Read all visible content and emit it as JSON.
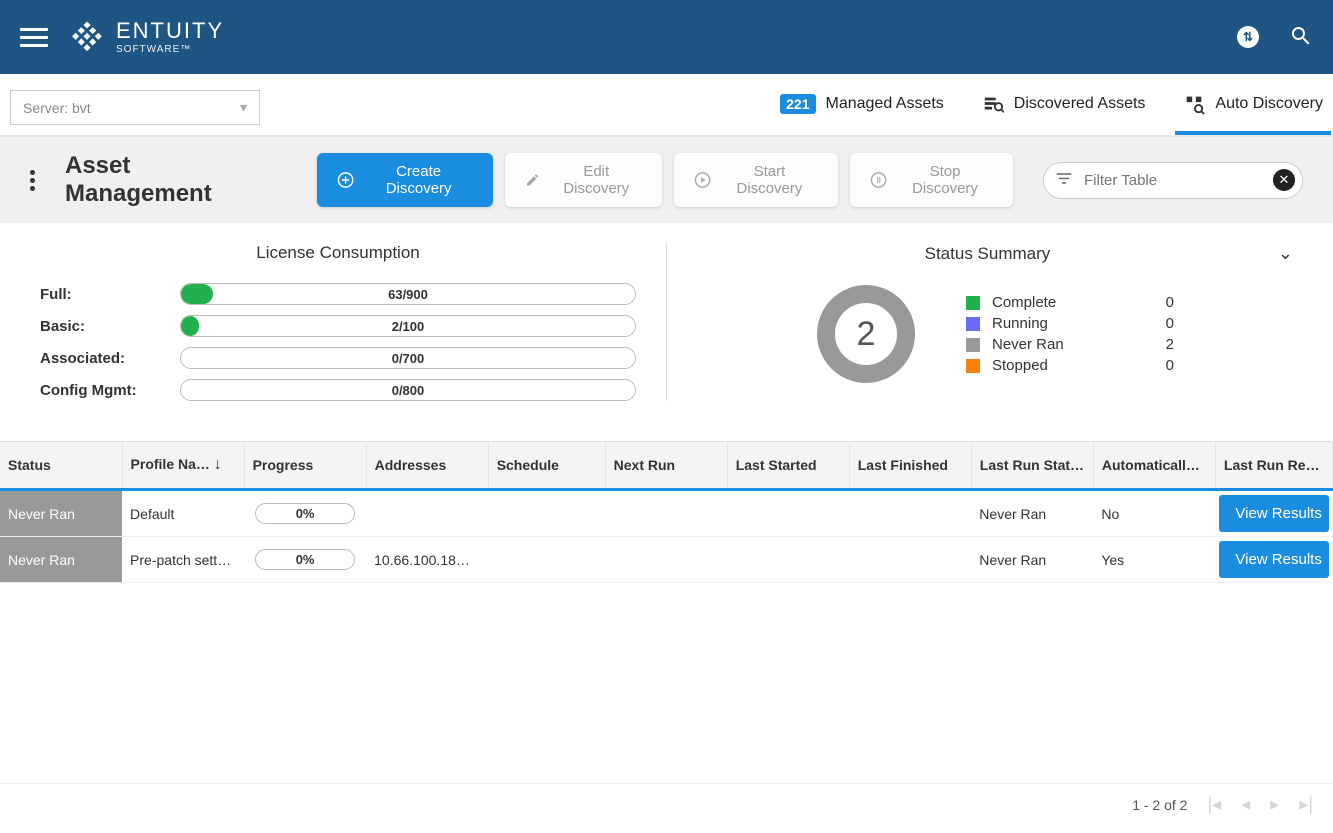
{
  "header": {
    "brand": "ENTUITY",
    "brand_sub": "SOFTWARE™"
  },
  "subheader": {
    "server_label": "Server:  bvt",
    "managed_count": "221",
    "managed_label": "Managed Assets",
    "discovered_label": "Discovered Assets",
    "auto_label": "Auto Discovery"
  },
  "toolbar": {
    "title": "Asset Management",
    "create": "Create Discovery",
    "edit": "Edit Discovery",
    "start": "Start Discovery",
    "stop": "Stop Discovery",
    "filter_placeholder": "Filter Table"
  },
  "license": {
    "title": "License Consumption",
    "rows": [
      {
        "label": "Full:",
        "text": "63/900",
        "percent": 7
      },
      {
        "label": "Basic:",
        "text": "2/100",
        "percent": 2
      },
      {
        "label": "Associated:",
        "text": "0/700",
        "percent": 0
      },
      {
        "label": "Config Mgmt:",
        "text": "0/800",
        "percent": 0
      }
    ]
  },
  "status": {
    "title": "Status Summary",
    "total": "2",
    "items": [
      {
        "label": "Complete",
        "value": "0",
        "color": "#21b04b"
      },
      {
        "label": "Running",
        "value": "0",
        "color": "#6b6bff"
      },
      {
        "label": "Never Ran",
        "value": "2",
        "color": "#999999"
      },
      {
        "label": "Stopped",
        "value": "0",
        "color": "#ff7f0e"
      }
    ]
  },
  "table": {
    "headers": [
      "Status",
      "Profile Na…",
      "Progress",
      "Addresses",
      "Schedule",
      "Next Run",
      "Last Started",
      "Last Finished",
      "Last Run Stat…",
      "Automatically…",
      "Last Run Res…"
    ],
    "rows": [
      {
        "status": "Never Ran",
        "profile": "Default",
        "progress": "0%",
        "addresses": "",
        "schedule": "",
        "nextrun": "",
        "laststarted": "",
        "lastfinished": "",
        "lastrunstat": "Never Ran",
        "auto": "No",
        "action": "View Results"
      },
      {
        "status": "Never Ran",
        "profile": "Pre-patch sett…",
        "progress": "0%",
        "addresses": "10.66.100.18…",
        "schedule": "",
        "nextrun": "",
        "laststarted": "",
        "lastfinished": "",
        "lastrunstat": "Never Ran",
        "auto": "Yes",
        "action": "View Results"
      }
    ]
  },
  "pagination": {
    "text": "1 - 2 of 2"
  }
}
